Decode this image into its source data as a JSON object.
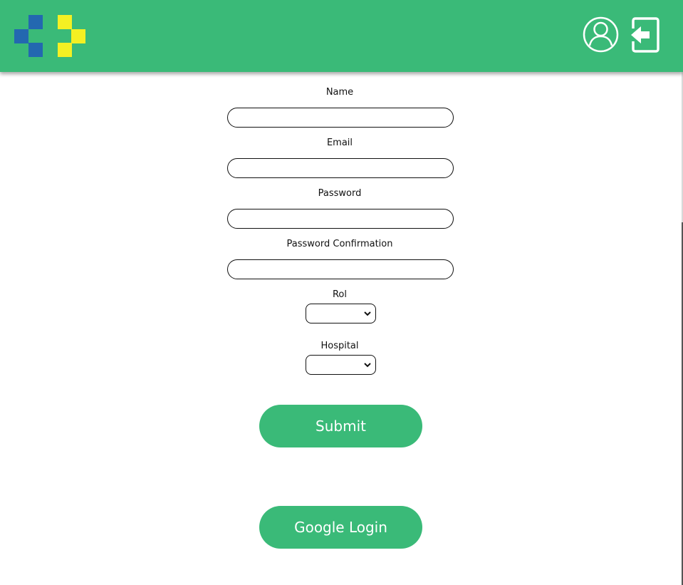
{
  "header": {
    "logo_icon": "hospital-cross-logo",
    "profile_icon": "user-circle-icon",
    "logout_icon": "logout-arrow-icon",
    "colors": {
      "primary": "#3aba78",
      "logo_blue": "#2368b0",
      "logo_yellow": "#f4f023"
    }
  },
  "form": {
    "name_label": "Name",
    "name_value": "",
    "email_label": "Email",
    "email_value": "",
    "password_label": "Password",
    "password_value": "",
    "password_confirmation_label": "Password Confirmation",
    "password_confirmation_value": "",
    "rol_label": "Rol",
    "rol_selected": "",
    "hospital_label": "Hospital",
    "hospital_selected": "",
    "submit_label": "Submit",
    "google_login_label": "Google Login"
  }
}
